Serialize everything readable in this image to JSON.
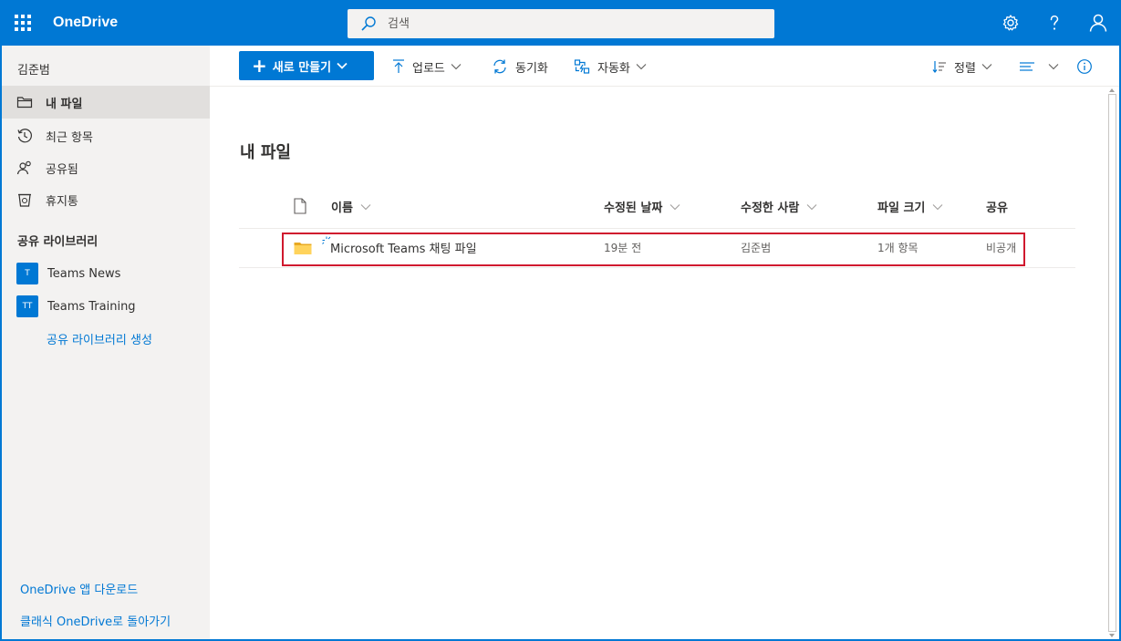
{
  "header": {
    "app_name": "OneDrive",
    "search": {
      "placeholder": "검색",
      "value": ""
    },
    "accent": "#0078d4"
  },
  "sidebar": {
    "user_name": "김준범",
    "items": [
      {
        "label": "내 파일",
        "icon": "folder-icon",
        "selected": true
      },
      {
        "label": "최근 항목",
        "icon": "history-icon"
      },
      {
        "label": "공유됨",
        "icon": "people-icon"
      },
      {
        "label": "휴지통",
        "icon": "recycle-bin-icon"
      }
    ],
    "libraries_title": "공유 라이브러리",
    "libraries": [
      {
        "badge": "T",
        "label": "Teams News"
      },
      {
        "badge": "TT",
        "label": "Teams Training"
      }
    ],
    "create_library": "공유 라이브러리 생성",
    "bottom_links": {
      "download_app": "OneDrive 앱 다운로드",
      "classic": "클래식 OneDrive로 돌아가기"
    }
  },
  "toolbar": {
    "new_label": "새로 만들기",
    "upload_label": "업로드",
    "sync_label": "동기화",
    "automate_label": "자동화",
    "sort_label": "정렬"
  },
  "main": {
    "title": "내 파일",
    "columns": {
      "name": "이름",
      "modified": "수정된 날짜",
      "modified_by": "수정한 사람",
      "size": "파일 크기",
      "sharing": "공유"
    },
    "rows": [
      {
        "name": "Microsoft Teams 채팅 파일",
        "modified": "19분 전",
        "modified_by": "김준범",
        "size": "1개 항목",
        "sharing": "비공개",
        "icon": "folder-icon"
      }
    ]
  }
}
